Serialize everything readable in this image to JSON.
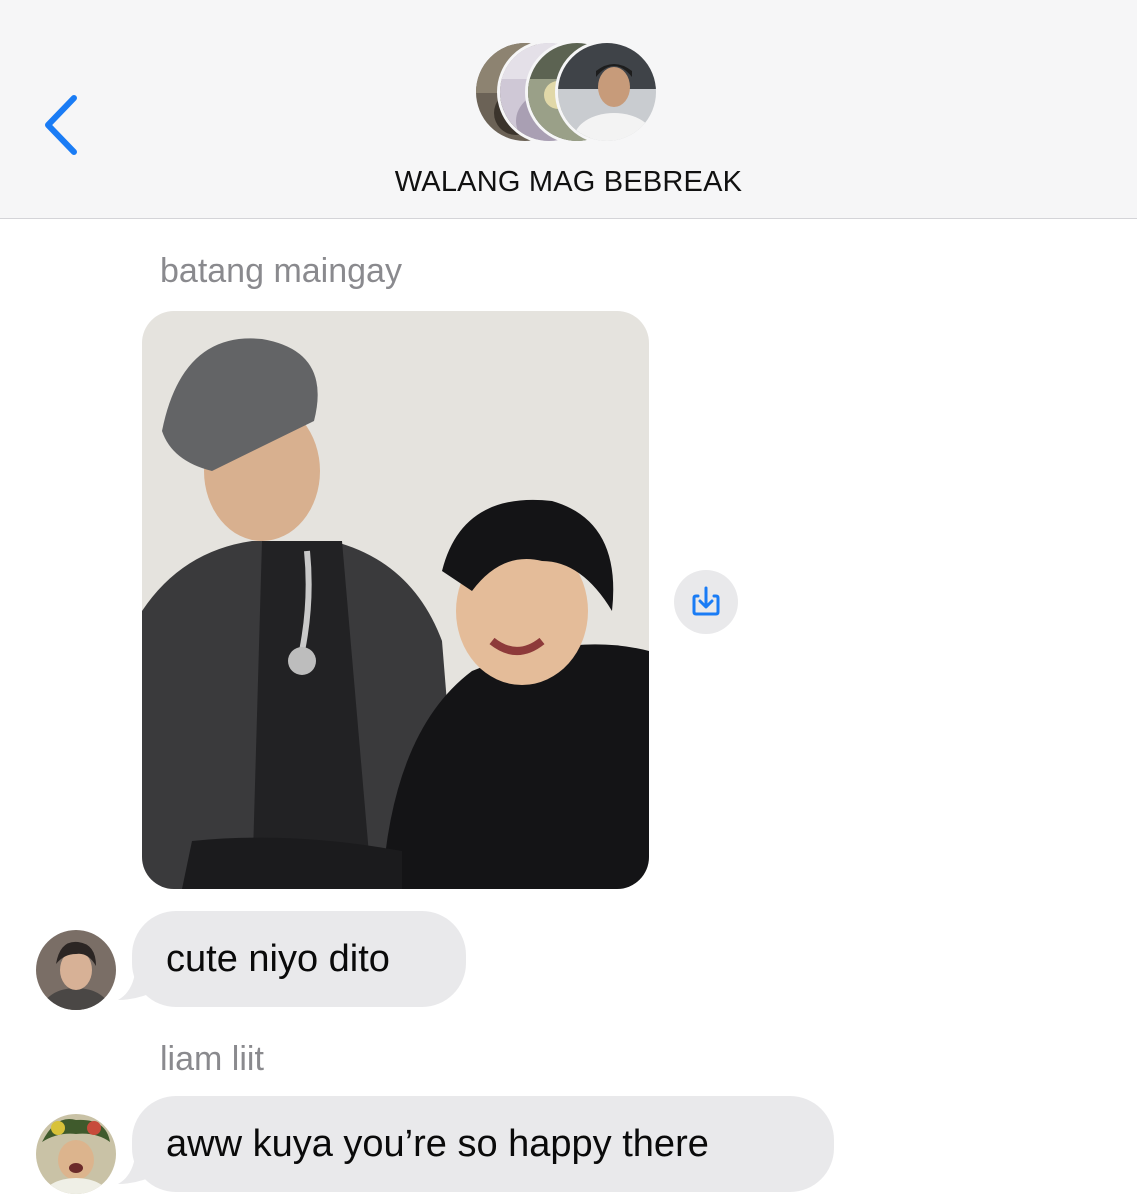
{
  "header": {
    "back_icon": "chevron-left-icon",
    "group_name": "WALANG MAG BEBREAK",
    "accent_color": "#1a7cf5",
    "participant_count_avatars": 4
  },
  "messages": [
    {
      "sender": "batang maingay",
      "type": "image",
      "save_icon": "share-save-icon"
    },
    {
      "sender": "",
      "type": "text",
      "text": "cute niyo dito"
    },
    {
      "sender": "liam liit",
      "type": "text",
      "text": "aww kuya you’re so happy there"
    }
  ],
  "colors": {
    "header_bg": "#f6f6f7",
    "bubble_bg": "#e9e9eb",
    "sender_name": "#8a8a8e"
  }
}
